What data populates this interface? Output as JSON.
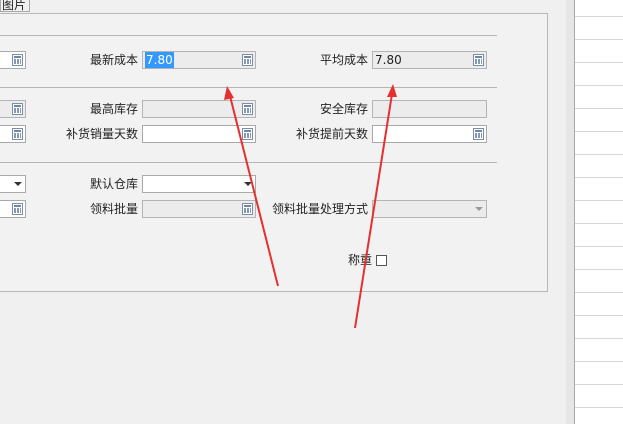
{
  "tab": {
    "label": "图片"
  },
  "row1": {
    "latest_cost_label": "最新成本",
    "latest_cost_value": "7.80",
    "average_cost_label": "平均成本",
    "average_cost_value": "7.80"
  },
  "row2": {
    "max_stock_label": "最高库存",
    "max_stock_value": "",
    "safe_stock_label": "安全库存",
    "safe_stock_value": ""
  },
  "row3": {
    "replenish_days_label": "补货销量天数",
    "replenish_days_value": "",
    "lead_days_label": "补货提前天数",
    "lead_days_value": ""
  },
  "row4": {
    "default_warehouse_label": "默认仓库",
    "default_warehouse_value": ""
  },
  "row5": {
    "batch_label": "领料批量",
    "batch_value": "",
    "batch_method_label": "领料批量处理方式",
    "batch_method_value": ""
  },
  "row6": {
    "weigh_label": "称重",
    "weigh_checked": false
  },
  "colors": {
    "selection": "#3399ff",
    "arrow": "#e53030",
    "panel_bg": "#f2f2f2"
  }
}
